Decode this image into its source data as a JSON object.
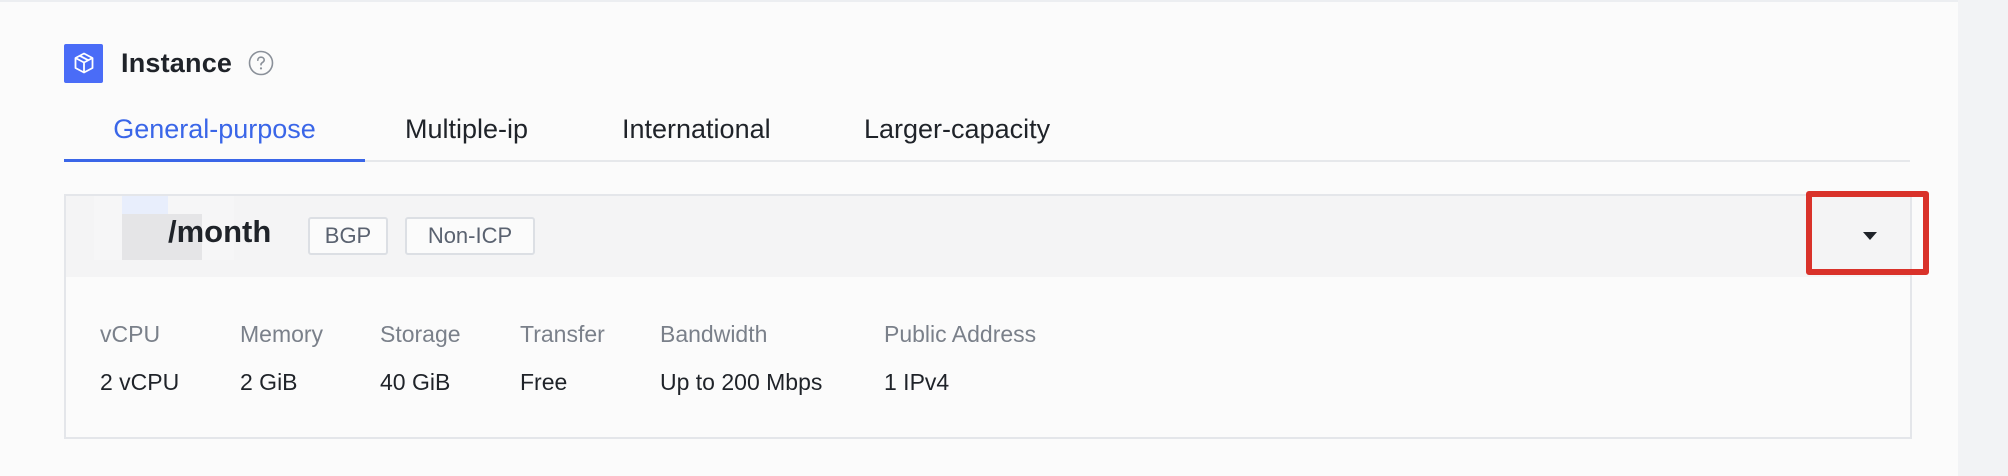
{
  "section": {
    "title": "Instance",
    "icon": "cube-icon",
    "help_icon": "question-circle-icon",
    "accent_color": "#4a6cf7"
  },
  "tabs": [
    {
      "label": "General-purpose",
      "active": true
    },
    {
      "label": "Multiple-ip",
      "active": false
    },
    {
      "label": "International",
      "active": false
    },
    {
      "label": "Larger-capacity",
      "active": false
    }
  ],
  "plan": {
    "price_unit": "/month",
    "tags": [
      "BGP",
      "Non-ICP"
    ],
    "expand_icon": "caret-down-icon",
    "specs": [
      {
        "label": "vCPU",
        "value": "2 vCPU"
      },
      {
        "label": "Memory",
        "value": "2 GiB"
      },
      {
        "label": "Storage",
        "value": "40 GiB"
      },
      {
        "label": "Transfer",
        "value": "Free"
      },
      {
        "label": "Bandwidth",
        "value": "Up to 200 Mbps"
      },
      {
        "label": "Public Address",
        "value": "1 IPv4"
      }
    ]
  },
  "colors": {
    "active_tab": "#3a66e8",
    "highlight": "#d9322a"
  }
}
